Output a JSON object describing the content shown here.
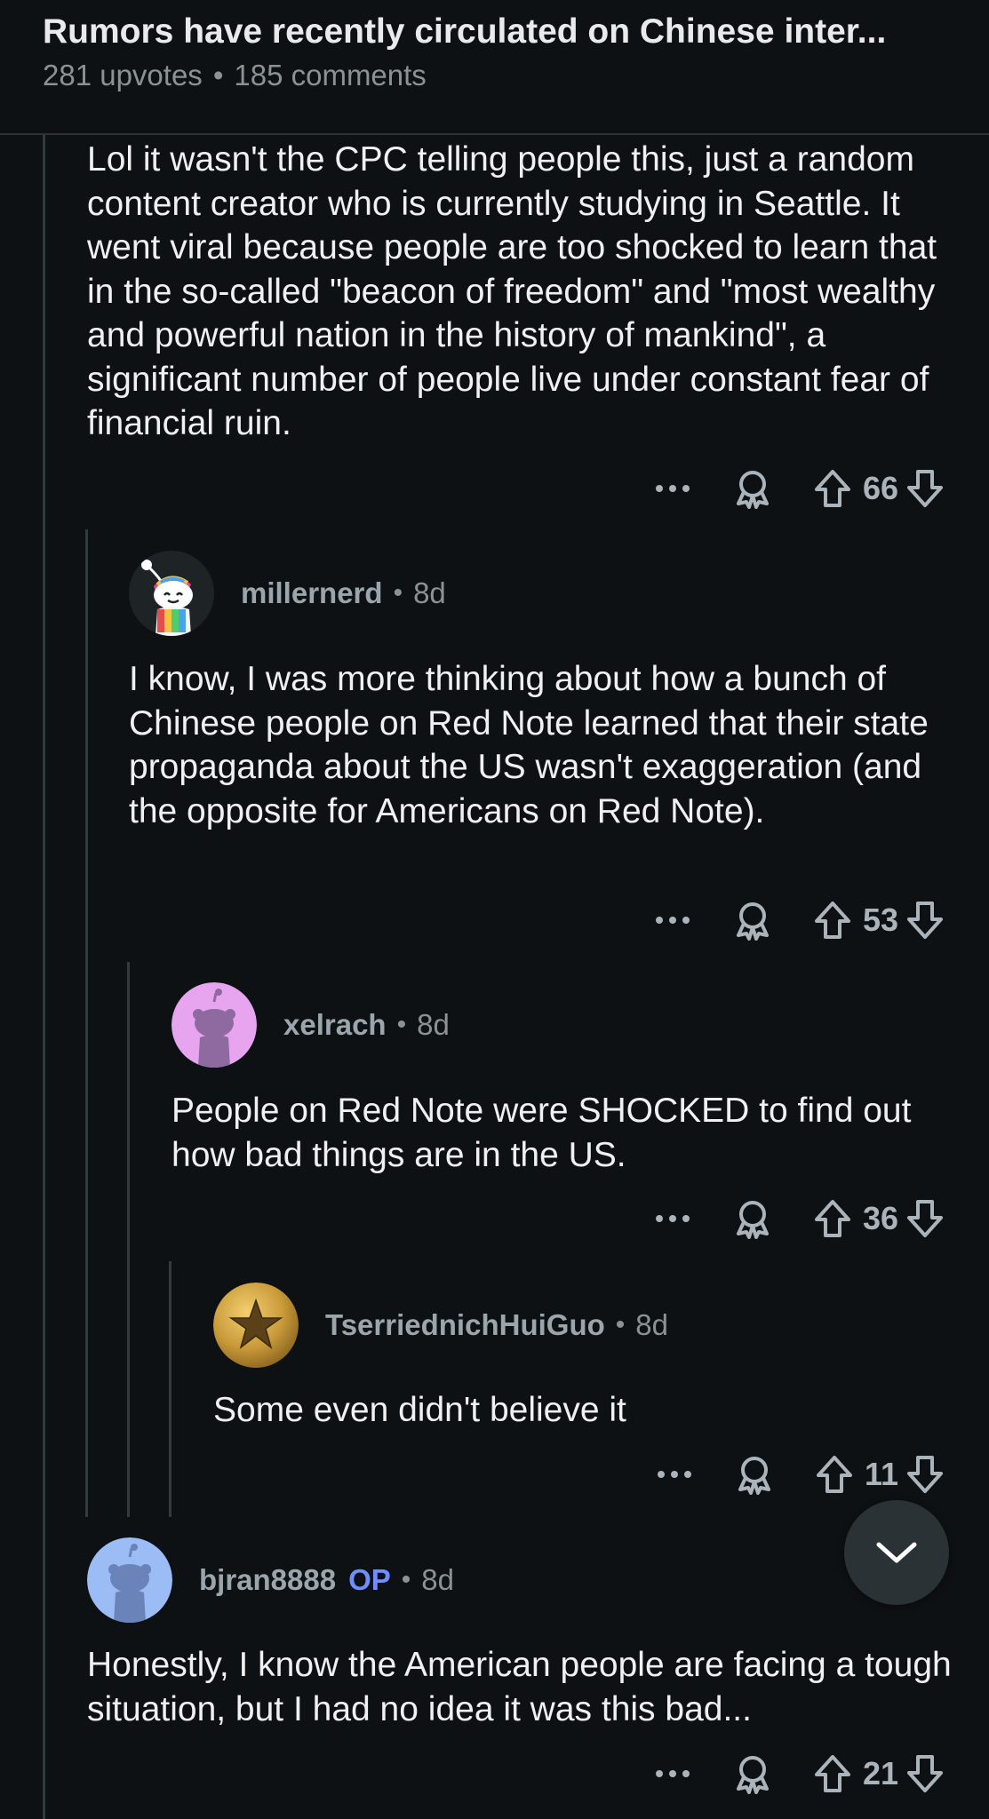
{
  "post": {
    "title": "Rumors have recently circulated on Chinese inter...",
    "upvotes": "281 upvotes",
    "separator": "•",
    "comments": "185 comments"
  },
  "comments": [
    {
      "body": "Lol it wasn't the CPC telling people this, just a random content creator who is currently studying in Seattle. It went viral because people are too shocked to learn that in the so-called \"beacon of freedom\" and \"most wealthy and powerful nation in the history of mankind\", a significant number of people live under constant fear of financial ruin.",
      "score": "66"
    },
    {
      "author": "millernerd",
      "age": "8d",
      "avatar_icon": "snoo-rainbow-avatar-icon",
      "body": "I know, I was more thinking about how a bunch of Chinese people on Red Note learned that their state propaganda about the US wasn't exaggeration (and the opposite for Americans on Red Note).",
      "score": "53"
    },
    {
      "author": "xelrach",
      "age": "8d",
      "avatar_icon": "default-snoo-purple-avatar-icon",
      "body": "People on Red Note were SHOCKED to find out how bad things are in the US.",
      "score": "36"
    },
    {
      "author": "TserriednichHuiGuo",
      "age": "8d",
      "avatar_icon": "gold-star-avatar-icon",
      "body": "Some even didn't believe it",
      "score": "11"
    },
    {
      "author": "bjran8888",
      "op_badge": "OP",
      "age": "8d",
      "avatar_icon": "default-snoo-blue-avatar-icon",
      "body": "Honestly, I know the American people are facing a tough situation, but I had no idea it was this bad...",
      "score": "21"
    }
  ],
  "meta_separator": "•",
  "icons": {
    "more": "more-options-icon",
    "award": "award-icon",
    "upvote": "upvote-arrow-icon",
    "downvote": "downvote-arrow-icon",
    "collapse": "chevron-down-icon"
  },
  "colors": {
    "background": "#0e1113",
    "text": "#eef0f1",
    "meta": "#8a9296",
    "username": "#9aa5ac",
    "op_badge": "#6f8fff",
    "thread_line": "#343b3f"
  }
}
